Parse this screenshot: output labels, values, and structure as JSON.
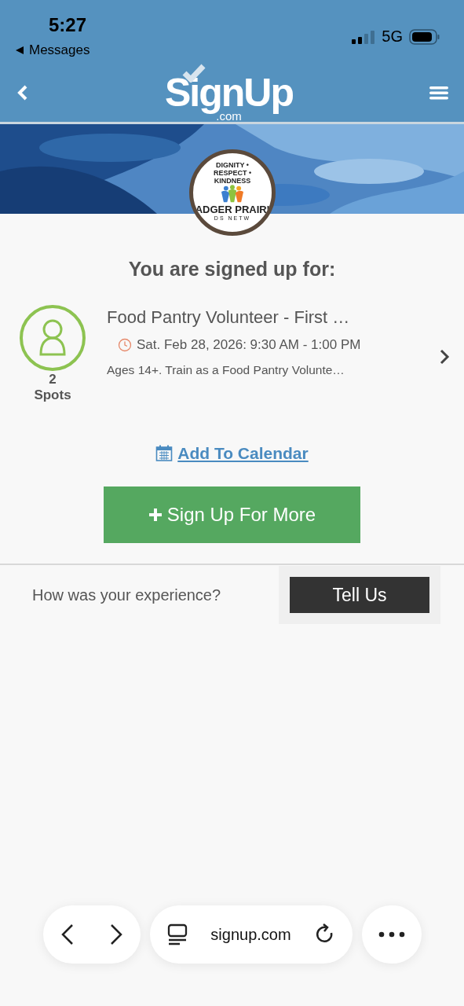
{
  "status_bar": {
    "time": "5:27",
    "back_label": "Messages",
    "network": "5G"
  },
  "header": {
    "logo_text": "SignUp",
    "logo_suffix": ".com"
  },
  "organization_logo": {
    "motto": "DIGNITY • RESPECT • KINDNESS",
    "name": "ADGER PRAIRI",
    "subtitle": "DS NETW"
  },
  "heading": "You are signed up for:",
  "signups": [
    {
      "title": "Food Pantry Volunteer - First …",
      "datetime": "Sat. Feb 28, 2026: 9:30 AM - 1:00 PM",
      "description": "Ages 14+. Train as a Food Pantry Volunte…",
      "spots_count": "2",
      "spots_label": "Spots"
    }
  ],
  "add_to_calendar": "Add To Calendar",
  "sign_up_more": "Sign Up For More",
  "feedback": {
    "question": "How was your experience?",
    "button": "Tell Us"
  },
  "browser_bar": {
    "url": "signup.com"
  }
}
